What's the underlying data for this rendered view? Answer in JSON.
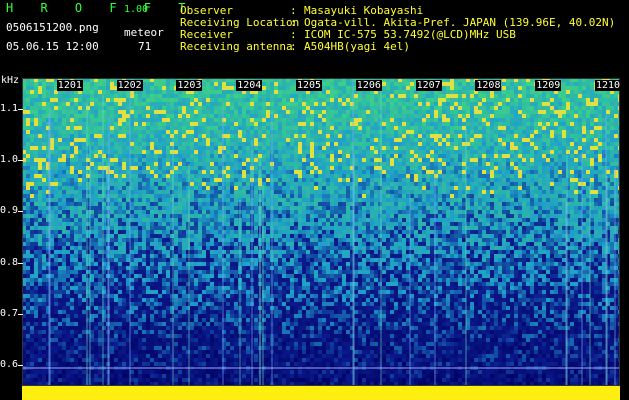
{
  "header": {
    "app_title": "H R O F F T",
    "version": "1.00",
    "filename": "0506151200.png",
    "timestamp": "05.06.15 12:00",
    "count_label": "meteor",
    "count_value": "71"
  },
  "meta": [
    {
      "label": "Observer",
      "value": "Masayuki Kobayashi"
    },
    {
      "label": "Receiving Location",
      "value": "Ogata-vill. Akita-Pref. JAPAN (139.96E, 40.02N)"
    },
    {
      "label": "Receiver",
      "value": "ICOM IC-575 53.7492(@LCD)MHz USB"
    },
    {
      "label": "Receiving antenna",
      "value": "A504HB(yagi 4el)"
    }
  ],
  "plot": {
    "unit": "kHz",
    "y_ticks": [
      "1.1",
      "1.0",
      "0.9",
      "0.8",
      "0.7",
      "0.6"
    ],
    "y_tick_values": [
      1.1,
      1.0,
      0.9,
      0.8,
      0.7,
      0.6
    ],
    "y_range": [
      0.56,
      1.16
    ],
    "x_labels": [
      "1201",
      "1202",
      "1203",
      "1204",
      "1205",
      "1206",
      "1207",
      "1208",
      "1209",
      "1210"
    ],
    "x_range": [
      1200,
      1210
    ],
    "colors": {
      "background_low": "#0a1a8c",
      "mid": "#1f9fc8",
      "high": "#3ccf8a",
      "noise_hot": "#e0e040",
      "band": "#ffef10"
    }
  }
}
